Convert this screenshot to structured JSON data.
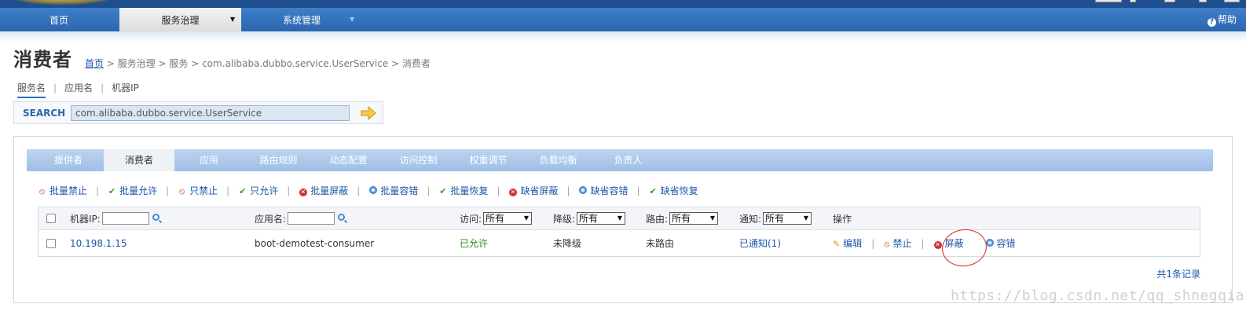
{
  "nav": {
    "items": [
      {
        "label": "首页"
      },
      {
        "label": "服务治理"
      },
      {
        "label": "系统管理"
      }
    ],
    "help": "帮助"
  },
  "page": {
    "title": "消费者",
    "breadcrumb": {
      "home": "首页",
      "rest": " > 服务治理 > 服务 > com.alibaba.dubbo.service.UserService > 消费者"
    }
  },
  "search": {
    "tabs": [
      "服务名",
      "应用名",
      "机器IP"
    ],
    "label": "SEARCH",
    "value": "com.alibaba.dubbo.service.UserService"
  },
  "subtabs": [
    "提供者",
    "消费者",
    "应用",
    "路由规则",
    "动态配置",
    "访问控制",
    "权重调节",
    "负载均衡",
    "负责人"
  ],
  "actions": [
    "批量禁止",
    "批量允许",
    "只禁止",
    "只允许",
    "批量屏蔽",
    "批量容错",
    "批量恢复",
    "缺省屏蔽",
    "缺省容错",
    "缺省恢复"
  ],
  "table": {
    "filters": {
      "ip_label": "机器IP:",
      "app_label": "应用名:",
      "access_label": "访问:",
      "access_value": "所有",
      "degrade_label": "降级:",
      "degrade_value": "所有",
      "route_label": "路由:",
      "route_value": "所有",
      "notify_label": "通知:",
      "notify_value": "所有",
      "ops_label": "操作"
    },
    "row": {
      "ip": "10.198.1.15",
      "app": "boot-demotest-consumer",
      "access": "已允许",
      "degrade": "未降级",
      "route": "未路由",
      "notify": "已通知(1)",
      "ops": [
        "编辑",
        "禁止",
        "屏蔽",
        "容错"
      ]
    },
    "total": "共1条记录"
  },
  "watermark": "https://blog.csdn.net/qq_shnegqiankong"
}
